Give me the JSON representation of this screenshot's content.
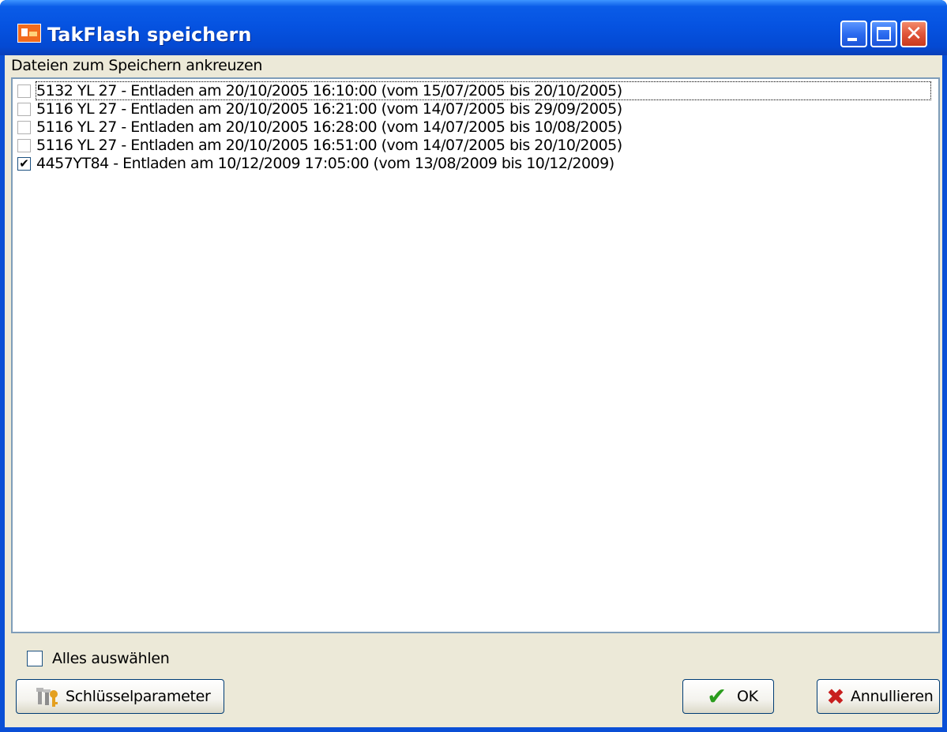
{
  "window": {
    "title": "TakFlash speichern",
    "controls": {
      "minimize": "minimize",
      "maximize": "maximize",
      "close": "✕"
    }
  },
  "list": {
    "header": "Dateien zum Speichern ankreuzen",
    "items": [
      {
        "label": "5132 YL 27 - Entladen am 20/10/2005 16:10:00 (vom 15/07/2005 bis 20/10/2005)",
        "checked": false
      },
      {
        "label": "5116 YL 27 - Entladen am 20/10/2005 16:21:00 (vom 14/07/2005 bis 29/09/2005)",
        "checked": false
      },
      {
        "label": "5116 YL 27 - Entladen am 20/10/2005 16:28:00 (vom 14/07/2005 bis 10/08/2005)",
        "checked": false
      },
      {
        "label": "5116 YL 27 - Entladen am 20/10/2005 16:51:00 (vom 14/07/2005 bis 20/10/2005)",
        "checked": false
      },
      {
        "label": "4457YT84 - Entladen am 10/12/2009 17:05:00 (vom 13/08/2009 bis 10/12/2009)",
        "checked": true
      }
    ]
  },
  "select_all": {
    "label": "Alles auswählen",
    "checked": false
  },
  "buttons": {
    "params_label": "Schlüsselparameter",
    "ok_label": "OK",
    "cancel_label": "Annullieren"
  },
  "icons": {
    "app": "takflash-app-icon",
    "params": "key-parameters-icon",
    "ok": "checkmark-icon",
    "cancel": "red-x-icon"
  },
  "colors": {
    "titlebar": "#0552e0",
    "close_button": "#e0553a",
    "dialog_bg": "#ece9d8",
    "ok_check": "#2a9c1d",
    "cancel_x": "#c81e1e"
  }
}
